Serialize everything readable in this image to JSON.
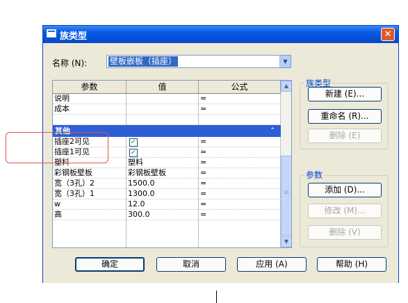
{
  "window": {
    "title": "族类型",
    "close_glyph": "✕"
  },
  "name_row": {
    "label": "名称 (N):",
    "value": "壁板嵌板（插座）",
    "dropdown_glyph": "▼"
  },
  "table": {
    "headers": [
      "参数",
      "值",
      "公式"
    ],
    "rows_top": [
      {
        "param": "说明",
        "value": "",
        "formula": "="
      },
      {
        "param": "成本",
        "value": "",
        "formula": "="
      }
    ],
    "group": {
      "label": "其他",
      "chevron": "⌃"
    },
    "rows_other": [
      {
        "param": "插座2可见",
        "value": "",
        "checked": true,
        "formula": "="
      },
      {
        "param": "插座1可见",
        "value": "",
        "checked": true,
        "formula": "="
      },
      {
        "param": "塑料",
        "value": "塑料",
        "formula": "="
      },
      {
        "param": "彩钢板壁板",
        "value": "彩钢板壁板",
        "formula": "="
      },
      {
        "param": "宽（3孔）2",
        "value": "1500.0",
        "formula": "="
      },
      {
        "param": "宽（3孔）1",
        "value": "1300.0",
        "formula": "="
      },
      {
        "param": "w",
        "value": "12.0",
        "formula": "="
      },
      {
        "param": "高",
        "value": "300.0",
        "formula": "="
      }
    ],
    "scroll_up": "▲",
    "scroll_down": "▼"
  },
  "family_types": {
    "label": "族类型",
    "new_button": "新建 (E)...",
    "rename_button": "重命名 (R)...",
    "delete_button": "删除 (E)"
  },
  "params": {
    "label": "参数",
    "add_button": "添加 (D)...",
    "modify_button": "修改 (M)...",
    "delete_button": "删除 (V)"
  },
  "footer": {
    "ok": "确定",
    "cancel": "取消",
    "apply": "应用 (A)",
    "help": "帮助 (H)"
  },
  "colors": {
    "titlebar": "#0552d8",
    "selection": "#316ac5",
    "annotation": "#e05050"
  }
}
